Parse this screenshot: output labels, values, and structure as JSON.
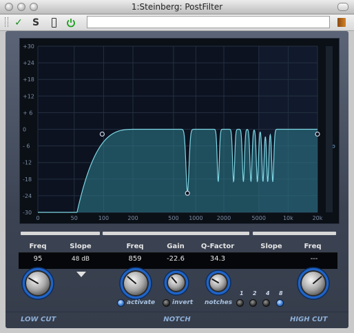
{
  "window": {
    "title": "1:Steinberg: PostFilter"
  },
  "toolbar": {
    "icons": [
      "checkmark-icon",
      "s-icon",
      "bracket-icon",
      "power-icon",
      "book-icon"
    ],
    "colors": {
      "check": "#1a8a1a",
      "power": "#19a019",
      "book": "#c2701b"
    }
  },
  "graph": {
    "y_ticks": [
      "+30",
      "+24",
      "+18",
      "+12",
      "+ 6",
      "0",
      "- 6",
      "-12",
      "-18",
      "-24",
      "-30"
    ],
    "x_ticks": [
      "0",
      "50",
      "100",
      "200",
      "500",
      "1000",
      "2000",
      "5000",
      "10k",
      "20k"
    ],
    "right_label": "-oo",
    "colors": {
      "fill": "#2f7f8f",
      "curve": "#7fd8e6",
      "background": "#0b1017",
      "grid": "#243041"
    },
    "low_cut_freq_hz": 95,
    "notch_freq_hz": 859,
    "notch_count": 8,
    "notch_depth_db": -22.6
  },
  "lowcut": {
    "freq_label": "Freq",
    "slope_label": "Slope",
    "freq_value": "95",
    "slope_value": "48 dB",
    "section_label": "LOW CUT"
  },
  "notch": {
    "freq_label": "Freq",
    "gain_label": "Gain",
    "q_label": "Q-Factor",
    "freq_value": "859",
    "gain_value": "-22.6",
    "q_value": "34.3",
    "activate_label": "activate",
    "invert_label": "invert",
    "notches_label": "notches",
    "notch_options": [
      "1",
      "2",
      "4",
      "8"
    ],
    "notch_selected": "8",
    "activate_on": true,
    "section_label": "NOTCH"
  },
  "highcut": {
    "slope_label": "Slope",
    "freq_label": "Freq",
    "freq_value": "---",
    "section_label": "HIGH CUT"
  }
}
